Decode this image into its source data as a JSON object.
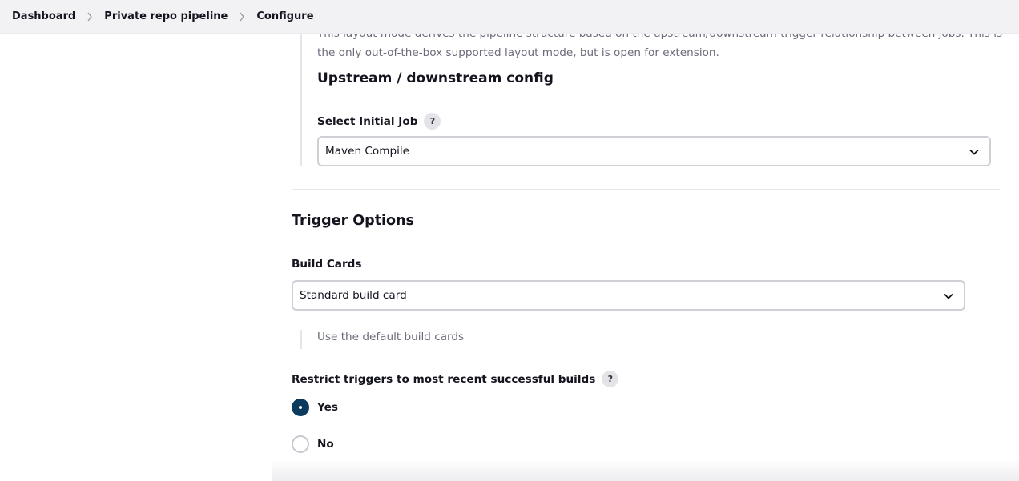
{
  "breadcrumb": {
    "items": [
      "Dashboard",
      "Private repo pipeline",
      "Configure"
    ]
  },
  "layout_description": "This layout mode derives the pipeline structure based on the upstream/downstream trigger relationship between jobs. This is the only out-of-the-box supported layout mode, but is open for extension.",
  "upstream": {
    "heading": "Upstream / downstream config",
    "initial_job_label": "Select Initial Job",
    "initial_job_value": "Maven Compile",
    "help_glyph": "?"
  },
  "trigger": {
    "heading": "Trigger Options",
    "build_cards_label": "Build Cards",
    "build_cards_value": "Standard build card",
    "build_cards_hint": "Use the default build cards",
    "restrict_label": "Restrict triggers to most recent successful builds",
    "help_glyph": "?",
    "options": [
      {
        "label": "Yes",
        "selected": true
      },
      {
        "label": "No",
        "selected": false
      }
    ]
  },
  "colors": {
    "radio_selected": "#0b3a5c",
    "topbar_bg": "#f2f2f4"
  }
}
